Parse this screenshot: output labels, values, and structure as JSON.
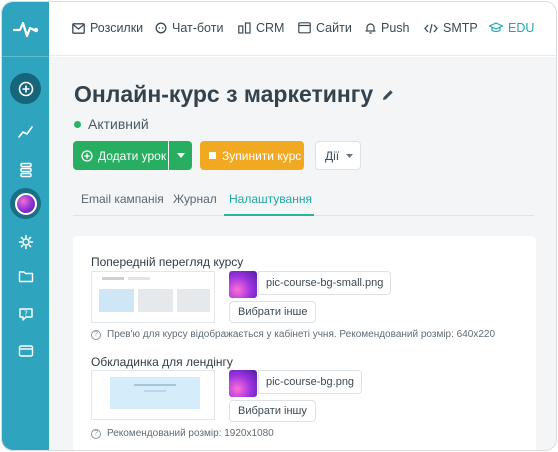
{
  "nav": {
    "items": [
      {
        "label": "Розсилки",
        "icon": "mail-icon"
      },
      {
        "label": "Чат-боти",
        "icon": "chat-bot-icon"
      },
      {
        "label": "CRM",
        "icon": "crm-icon"
      },
      {
        "label": "Сайти",
        "icon": "website-icon"
      },
      {
        "label": "Push",
        "icon": "bell-icon"
      },
      {
        "label": "SMTP",
        "icon": "code-icon"
      },
      {
        "label": "EDU",
        "icon": "graduation-cap-icon"
      }
    ],
    "active": "EDU"
  },
  "course": {
    "title": "Онлайн-курс з маркетингу",
    "status": "Активний"
  },
  "actions": {
    "add_lesson": "Додати урок",
    "stop_course": "Зупинити курс",
    "actions_menu": "Дії"
  },
  "tabs": [
    {
      "label": "Email кампанія"
    },
    {
      "label": "Журнал"
    },
    {
      "label": "Налаштування"
    }
  ],
  "active_tab": "Налаштування",
  "settings": {
    "preview": {
      "label": "Попередній перегляд курсу",
      "file": "pic-course-bg-small.png",
      "choose": "Вибрати інше",
      "hint": "Прев'ю для курсу відображається у кабінеті учня. Рекомендований розмір: 640x220"
    },
    "cover": {
      "label": "Обкладинка для лендінгу",
      "file": "pic-course-bg.png",
      "choose": "Вибрати іншу",
      "hint": "Рекомендований розмір: 1920x1080"
    }
  },
  "colors": {
    "sidebar": "#2fa4be",
    "primary_green": "#27ae60",
    "warning_orange": "#f2a922",
    "accent_teal": "#1ba7b3"
  }
}
